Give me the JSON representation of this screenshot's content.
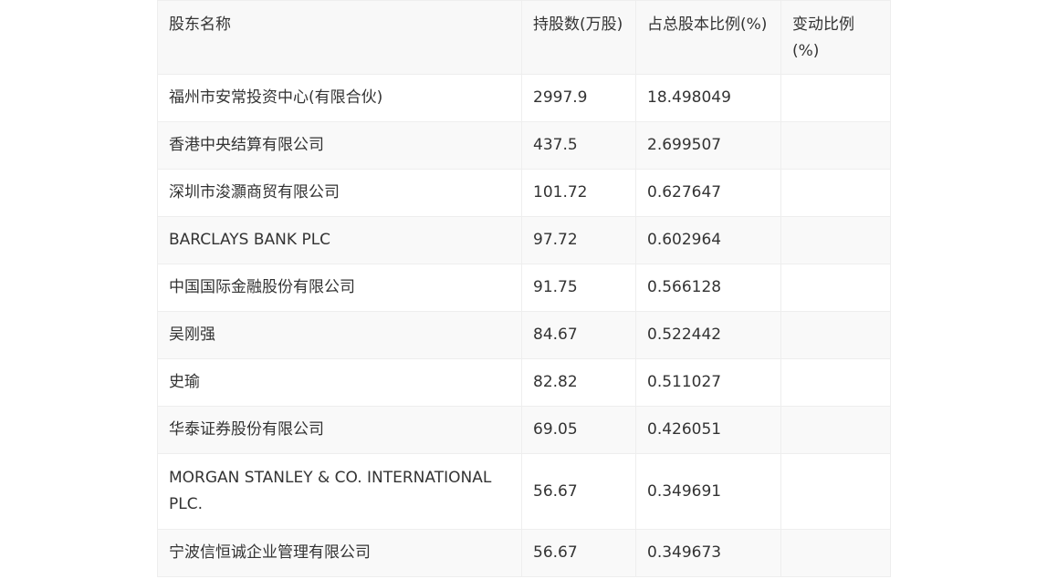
{
  "table": {
    "headers": {
      "name": "股东名称",
      "shares": "持股数(万股)",
      "ratio": "占总股本比例(%)",
      "change": "变动比例(%)"
    },
    "rows": [
      {
        "name": "福州市安常投资中心(有限合伙)",
        "shares": "2997.9",
        "ratio": "18.498049",
        "change": ""
      },
      {
        "name": "香港中央结算有限公司",
        "shares": "437.5",
        "ratio": "2.699507",
        "change": ""
      },
      {
        "name": "深圳市浚灝商贸有限公司",
        "shares": "101.72",
        "ratio": "0.627647",
        "change": ""
      },
      {
        "name": "BARCLAYS BANK PLC",
        "shares": "97.72",
        "ratio": "0.602964",
        "change": ""
      },
      {
        "name": "中国国际金融股份有限公司",
        "shares": "91.75",
        "ratio": "0.566128",
        "change": ""
      },
      {
        "name": "吴刚强",
        "shares": "84.67",
        "ratio": "0.522442",
        "change": ""
      },
      {
        "name": "史瑜",
        "shares": "82.82",
        "ratio": "0.511027",
        "change": ""
      },
      {
        "name": "华泰证券股份有限公司",
        "shares": "69.05",
        "ratio": "0.426051",
        "change": ""
      },
      {
        "name": "MORGAN STANLEY & CO. INTERNATIONAL PLC.",
        "shares": "56.67",
        "ratio": "0.349691",
        "change": ""
      },
      {
        "name": "宁波信恒诚企业管理有限公司",
        "shares": "56.67",
        "ratio": "0.349673",
        "change": ""
      }
    ]
  },
  "colors": {
    "text": "#333333",
    "border": "#eeeeee",
    "header_bg": "#f8f8f8",
    "stripe_bg": "#f9f9f9"
  }
}
